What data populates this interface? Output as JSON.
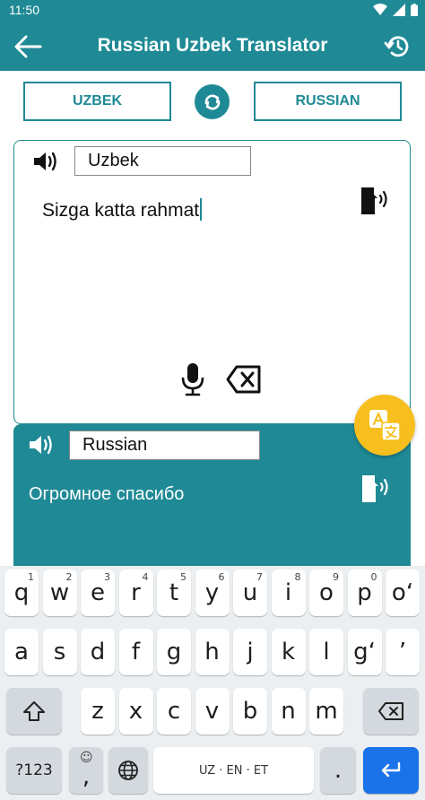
{
  "status_bar": {
    "time": "11:50"
  },
  "app_bar": {
    "title": "Russian Uzbek Translator"
  },
  "languages": {
    "source_button": "UZBEK",
    "target_button": "RUSSIAN"
  },
  "source_panel": {
    "lang_field": "Uzbek",
    "text": "Sizga katta rahmat"
  },
  "target_panel": {
    "lang_field": "Russian",
    "text": "Огромное спасибо"
  },
  "keyboard": {
    "row1": [
      {
        "label": "q",
        "hint": "1"
      },
      {
        "label": "w",
        "hint": "2"
      },
      {
        "label": "e",
        "hint": "3"
      },
      {
        "label": "r",
        "hint": "4"
      },
      {
        "label": "t",
        "hint": "5"
      },
      {
        "label": "y",
        "hint": "6"
      },
      {
        "label": "u",
        "hint": "7"
      },
      {
        "label": "i",
        "hint": "8"
      },
      {
        "label": "o",
        "hint": "9"
      },
      {
        "label": "p",
        "hint": "0"
      },
      {
        "label": "o‘",
        "hint": ""
      }
    ],
    "row2": [
      "a",
      "s",
      "d",
      "f",
      "g",
      "h",
      "j",
      "k",
      "l",
      "g‘",
      "’"
    ],
    "row3": [
      "z",
      "x",
      "c",
      "v",
      "b",
      "n",
      "m"
    ],
    "sym_label": "?123",
    "emoji_label": "☺",
    "comma_label": ",",
    "period_label": ".",
    "space_label": "UZ · EN · ET"
  },
  "colors": {
    "primary": "#1f8a95",
    "fab": "#f7bf1e",
    "enter": "#1a73e8"
  }
}
